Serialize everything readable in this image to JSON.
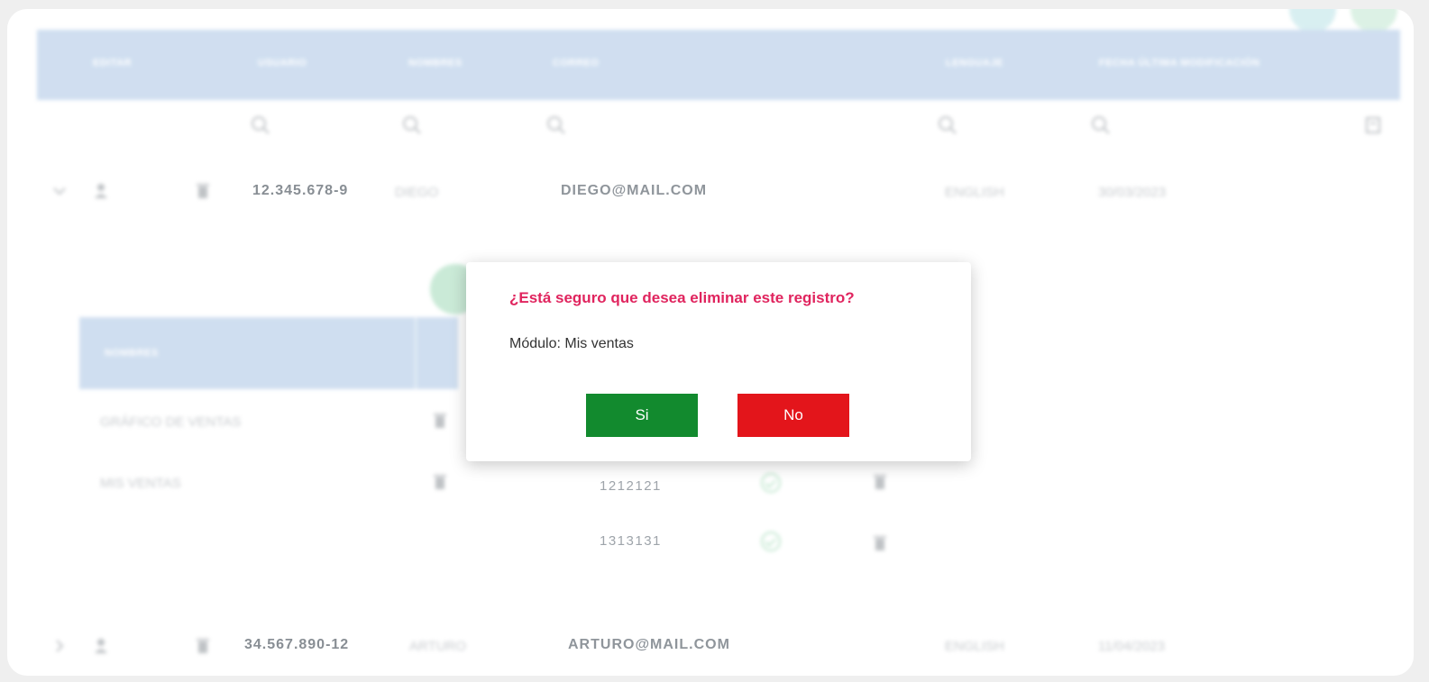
{
  "table": {
    "headers": [
      "EDITAR",
      "USUARIO",
      "NOMBRES",
      "CORREO",
      "LENGUAJE",
      "FECHA ÚLTIMA MODIFICACIÓN"
    ],
    "rows": [
      {
        "usuario": "12.345.678-9",
        "nombres": "DIEGO",
        "correo": "DIEGO@MAIL.COM",
        "lenguaje": "ENGLISH",
        "fecha": "30/03/2023"
      },
      {
        "usuario": "34.567.890-12",
        "nombres": "ARTURO",
        "correo": "ARTURO@MAIL.COM",
        "lenguaje": "ENGLISH",
        "fecha": "11/04/2023"
      }
    ]
  },
  "subtable": {
    "header": "NOMBRES",
    "rows": [
      "GRÁFICO DE VENTAS",
      "MIS VENTAS"
    ],
    "codes": [
      "1212121",
      "1313131"
    ]
  },
  "dialog": {
    "title": "¿Está seguro que desea eliminar este registro?",
    "message": "Módulo: Mis ventas",
    "yes_label": "Si",
    "no_label": "No",
    "yes_color": "#128a2e",
    "no_color": "#e3151b",
    "title_color": "#e0245e"
  }
}
